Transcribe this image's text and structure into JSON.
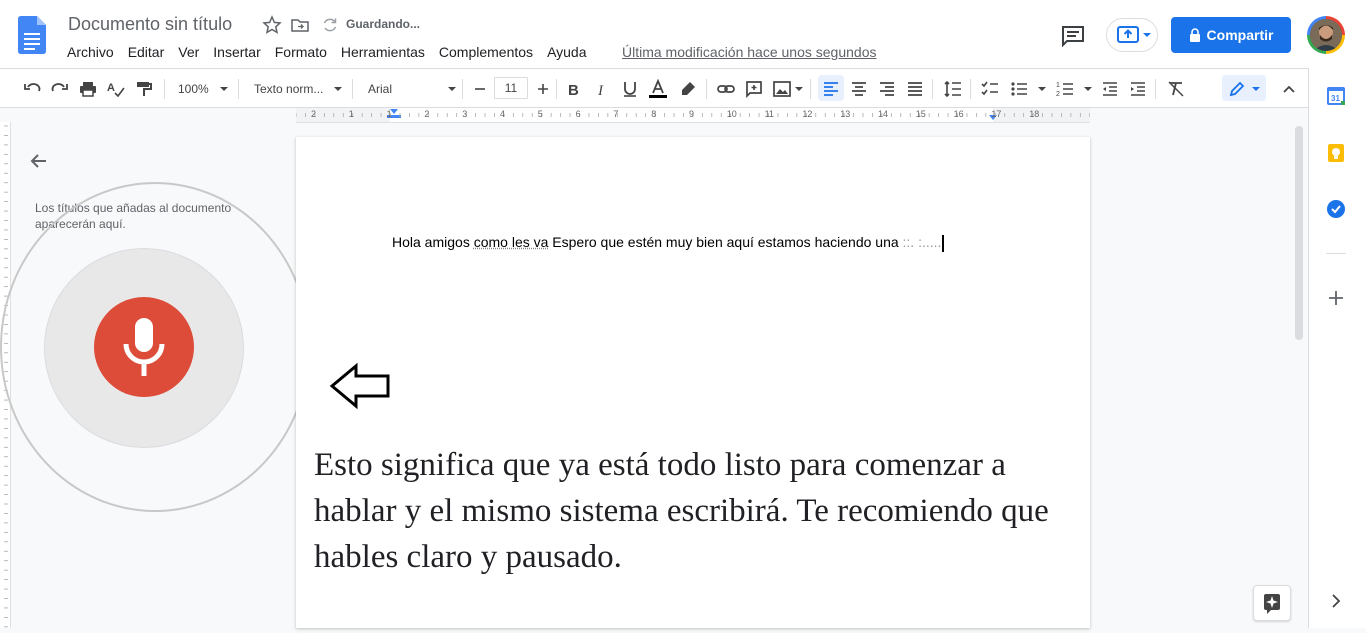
{
  "header": {
    "doc_title": "Documento sin título",
    "saving_status": "Guardando...",
    "menu": [
      "Archivo",
      "Editar",
      "Ver",
      "Insertar",
      "Formato",
      "Herramientas",
      "Complementos",
      "Ayuda"
    ],
    "last_edit": "Última modificación hace unos segundos",
    "share_label": "Compartir"
  },
  "toolbar": {
    "zoom": "100%",
    "style": "Texto norm...",
    "font": "Arial",
    "font_size": "11"
  },
  "ruler": {
    "labels": [
      "2",
      "1",
      "1",
      "2",
      "3",
      "4",
      "5",
      "6",
      "7",
      "8",
      "9",
      "10",
      "11",
      "12",
      "13",
      "14",
      "15",
      "16",
      "17",
      "18"
    ]
  },
  "outline": {
    "hint": "Los títulos que añadas al documento aparecerán aquí."
  },
  "document": {
    "text_before": "Hola amigos ",
    "text_underlined": "como les va",
    "text_after": " Espero que estén muy bien aquí estamos haciendo una",
    "text_dictating": " ::. :.....",
    "caption": "Esto significa que ya está todo listo para comenzar a hablar y el mismo sistema escribirá. Te recomiendo que hables claro y pausado."
  },
  "colors": {
    "accent": "#1a73e8",
    "mic": "#dd4b39",
    "docs_blue": "#4285f4"
  }
}
